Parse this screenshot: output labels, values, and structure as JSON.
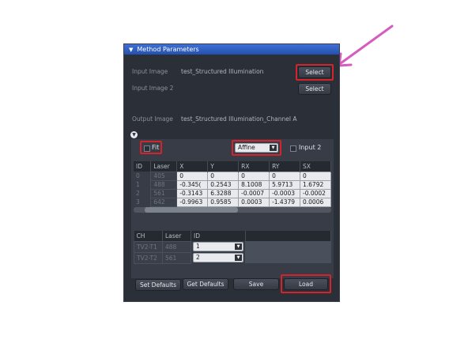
{
  "panel": {
    "title": "Method Parameters",
    "input_image_label": "Input Image",
    "input_image_value": "test_Structured Illumination",
    "input_image2_label": "Input Image 2",
    "output_image_label": "Output Image",
    "output_image_value": "test_Structured Illumination_Channel A",
    "select_label": "Select",
    "select2_label": "Select"
  },
  "options": {
    "fit_label": "Fit",
    "transform_value": "Affine",
    "input2_label": "Input 2"
  },
  "table1": {
    "headers": [
      "ID",
      "Laser",
      "X",
      "Y",
      "RX",
      "RY",
      "SX"
    ],
    "rows": [
      [
        "0",
        "405",
        "0",
        "0",
        "0",
        "0",
        "0"
      ],
      [
        "1",
        "488",
        "-0.345(",
        "0.2543",
        "8.1008",
        "5.9713",
        "1.6792"
      ],
      [
        "2",
        "561",
        "-0.3143",
        "6.3288",
        "-0.0007",
        "-0.0003",
        "-0.0002"
      ],
      [
        "3",
        "642",
        "-0.9963",
        "0.9585",
        "0.0003",
        "-1.4379",
        "0.0006"
      ]
    ]
  },
  "table2": {
    "headers": [
      "CH",
      "Laser",
      "ID"
    ],
    "rows": [
      [
        "TV2-T1",
        "488",
        "1"
      ],
      [
        "TV2-T2",
        "561",
        "2"
      ]
    ]
  },
  "buttons": {
    "set_defaults": "Set Defaults",
    "get_defaults": "Get Defaults",
    "save": "Save",
    "load": "Load"
  },
  "colors": {
    "highlight": "#d4242b",
    "arrow": "#d65dbd",
    "header": "#2451b0"
  }
}
